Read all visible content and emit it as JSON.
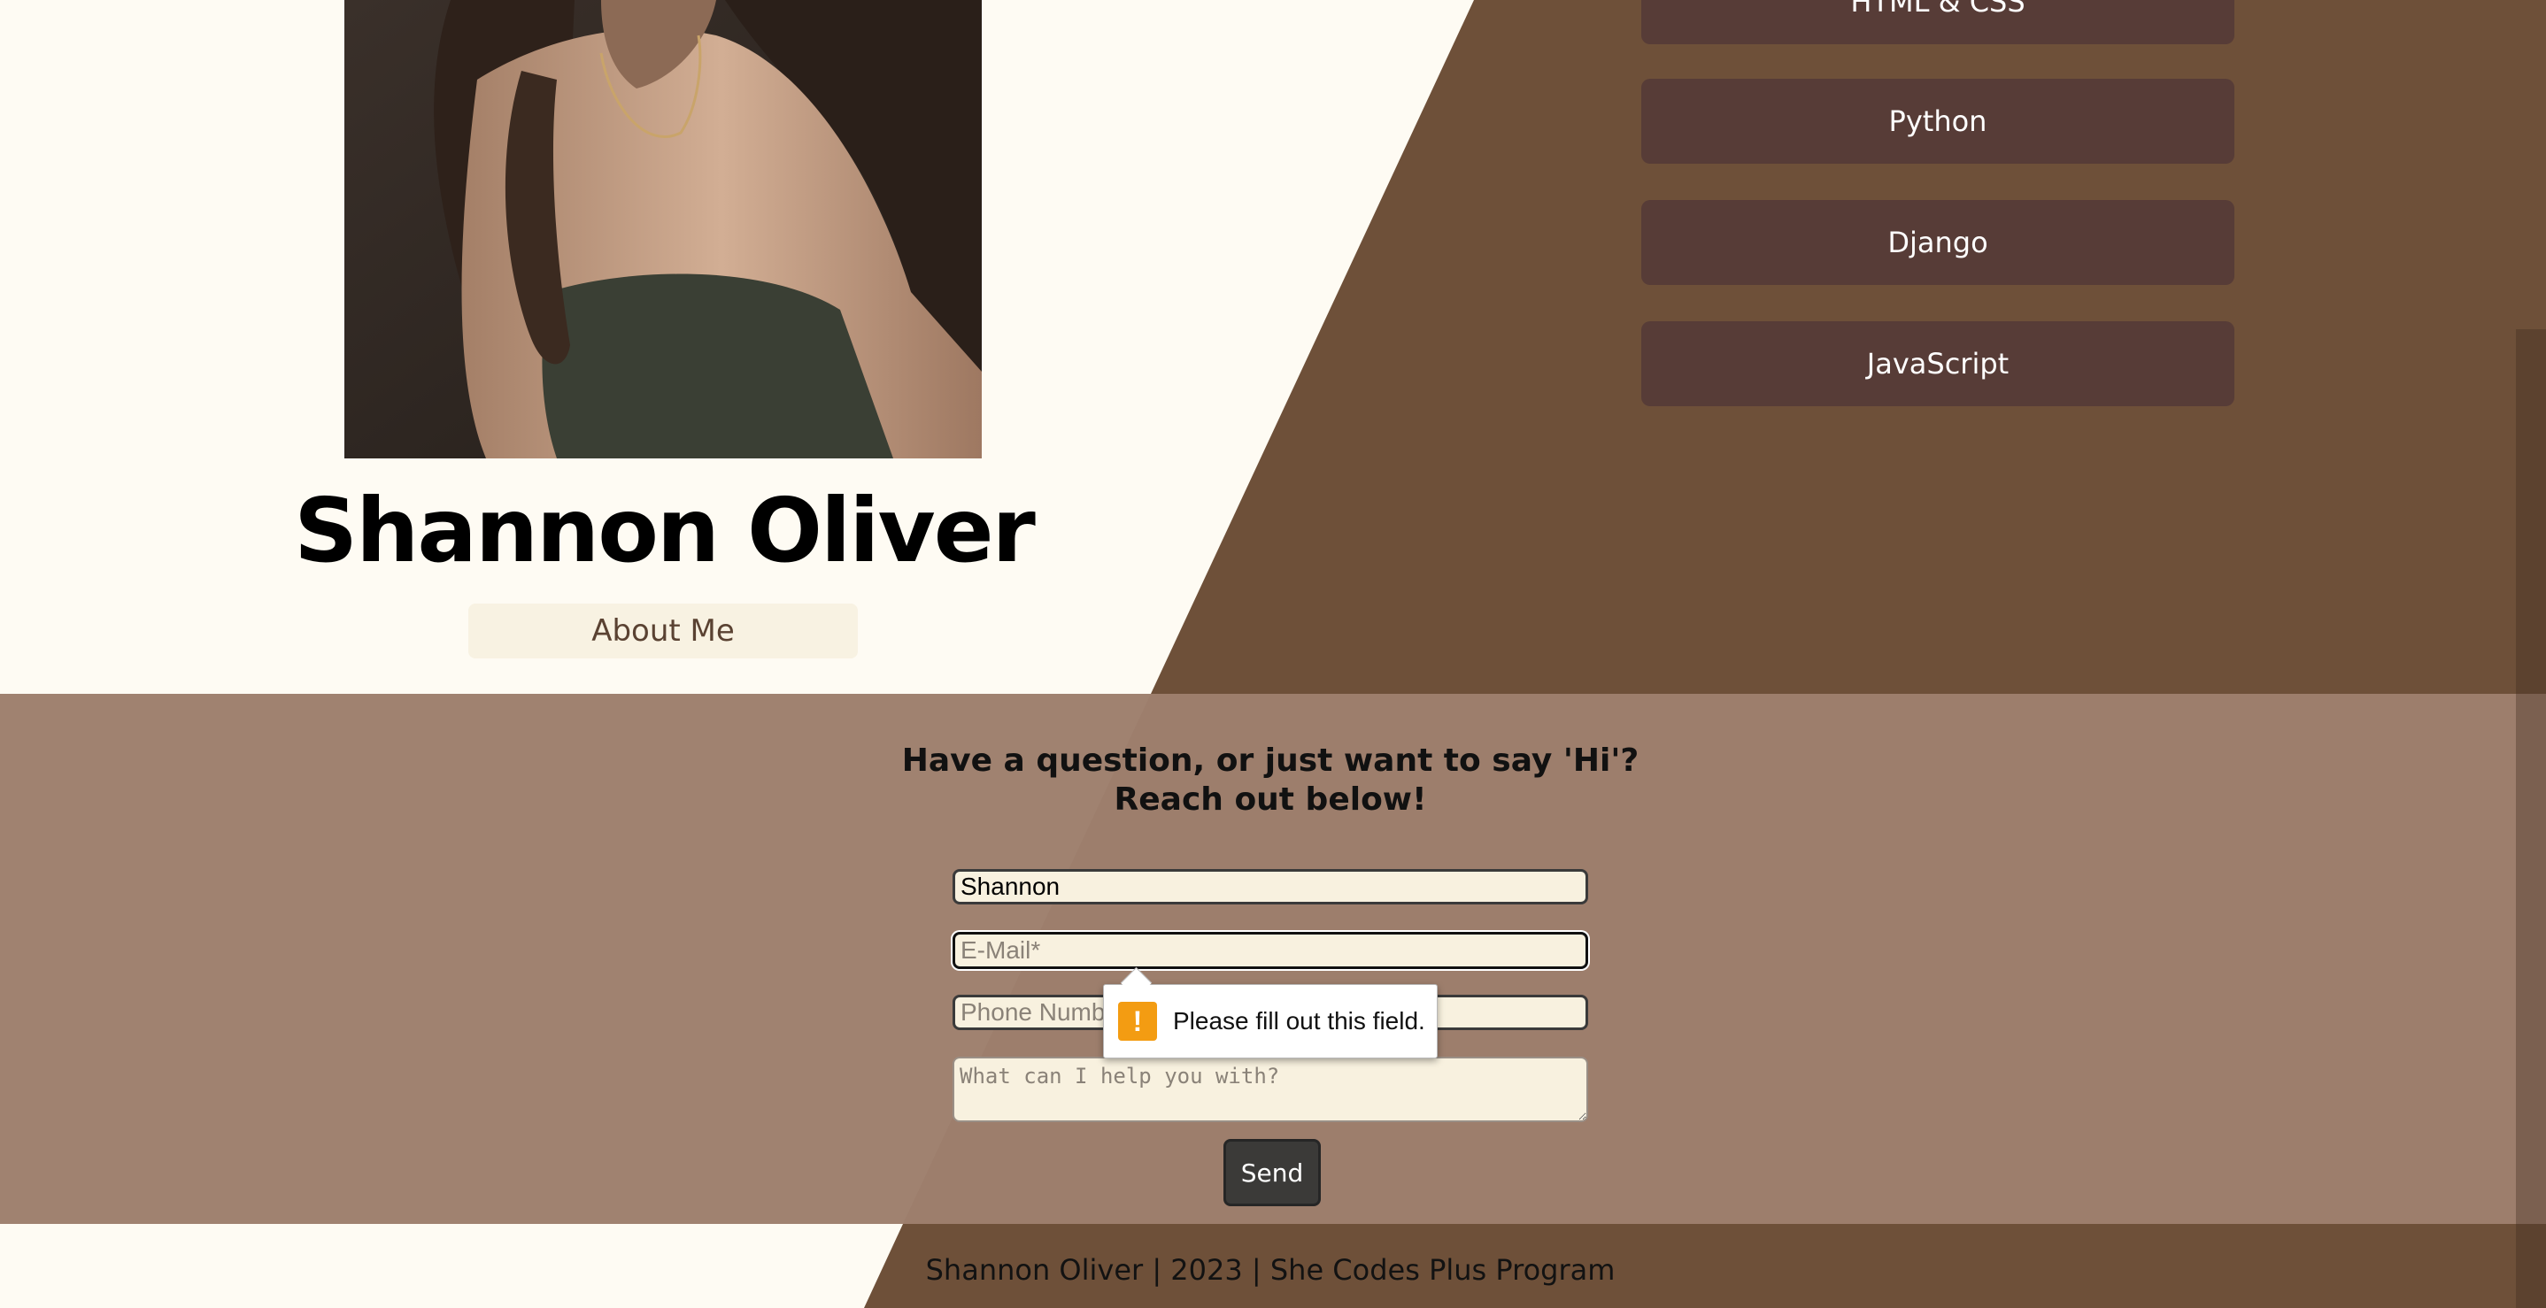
{
  "colors": {
    "page_background": "#fefbf3",
    "brown_panel": "#6e5039",
    "contact_overlay": "#a08270",
    "skill_button": "#573c37",
    "about_button_bg": "#f8f2e2",
    "send_button": "#3b3a38",
    "warning_icon": "#f39c12"
  },
  "profile": {
    "name": "Shannon Oliver",
    "about_label": "About Me",
    "photo": "portrait-photo"
  },
  "skills": [
    {
      "label": "HTML & CSS"
    },
    {
      "label": "Python"
    },
    {
      "label": "Django"
    },
    {
      "label": "JavaScript"
    }
  ],
  "contact": {
    "heading_line1": "Have a question, or just want to say 'Hi'?",
    "heading_line2": "Reach out below!",
    "name_value": "Shannon",
    "email_placeholder": "E-Mail*",
    "phone_placeholder": "Phone Number",
    "message_placeholder": "What can I help you with?",
    "send_label": "Send"
  },
  "validation": {
    "icon": "warning-icon",
    "icon_glyph": "!",
    "message": "Please fill out this field."
  },
  "footer": {
    "text": "Shannon Oliver | 2023 | She Codes Plus Program"
  }
}
